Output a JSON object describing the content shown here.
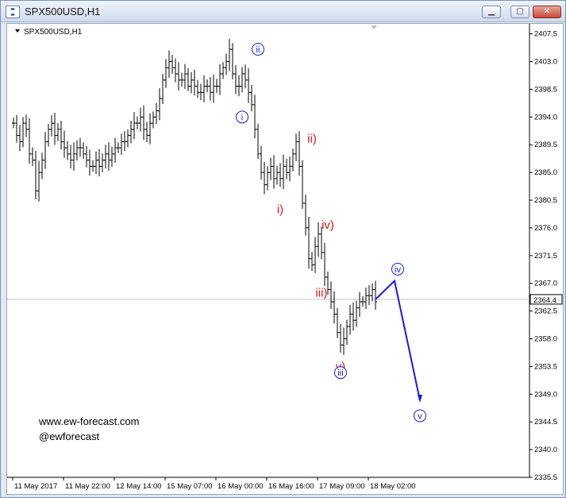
{
  "window": {
    "title": "SPX500USD,H1",
    "icon": "chart-window-icon",
    "buttons": {
      "minimize": "minimize-icon",
      "maximize": "maximize-icon",
      "close": "close-icon"
    }
  },
  "chart": {
    "symbol_label": "SPX500USD,H1",
    "watermark_line1": "www.ew-forecast.com",
    "watermark_line2": "@ewforecast",
    "current_price_label": "2364.4"
  },
  "chart_data": {
    "type": "bar",
    "title": "SPX500USD,H1",
    "ylim": [
      2335.5,
      2409.0
    ],
    "y_ticks": [
      2407.5,
      2403.0,
      2398.5,
      2394.0,
      2389.5,
      2385.0,
      2380.5,
      2376.0,
      2371.5,
      2367.0,
      2362.5,
      2358.0,
      2353.5,
      2349.0,
      2344.5,
      2340.0,
      2335.5
    ],
    "x_tick_labels": [
      "11 May 2017",
      "11 May 22:00",
      "12 May 14:00",
      "15 May 07:00",
      "16 May 00:00",
      "16 May 16:00",
      "17 May 09:00",
      "18 May 02:00"
    ],
    "x_tick_bars": [
      0,
      16,
      32,
      48,
      64,
      80,
      96,
      112
    ],
    "current_price": 2364.4,
    "ohlc_closes": [
      2393,
      2391,
      2390,
      2393,
      2392,
      2388,
      2387,
      2382,
      2385,
      2387,
      2390,
      2392,
      2393,
      2391,
      2392,
      2390,
      2389,
      2388,
      2387,
      2388,
      2389,
      2389,
      2388,
      2387,
      2386,
      2386,
      2387,
      2386,
      2387,
      2388,
      2387,
      2388,
      2389,
      2389,
      2390,
      2390,
      2391,
      2392,
      2393,
      2393,
      2394,
      2392,
      2391,
      2393,
      2394,
      2395,
      2397,
      2400,
      2402,
      2403,
      2402,
      2401,
      2400,
      2400,
      2401,
      2399,
      2400,
      2399,
      2398,
      2398,
      2399,
      2399,
      2398,
      2399,
      2399,
      2401,
      2402,
      2403,
      2405,
      2401,
      2399,
      2399,
      2401,
      2400,
      2398,
      2396,
      2392,
      2388,
      2385,
      2383,
      2385,
      2386,
      2384,
      2385,
      2384,
      2386,
      2385,
      2386,
      2388,
      2390,
      2386,
      2380,
      2376,
      2371,
      2370,
      2373,
      2375,
      2372,
      2368,
      2366,
      2364,
      2362,
      2359,
      2357,
      2358,
      2360,
      2362,
      2361,
      2363,
      2364,
      2364,
      2365,
      2365,
      2366,
      2364
    ],
    "projection": [
      {
        "bar": 114,
        "price": 2364.4
      },
      {
        "bar": 120,
        "price": 2367.4
      },
      {
        "bar": 128,
        "price": 2348.0
      }
    ],
    "annotations": [
      {
        "label": "i",
        "bar": 72,
        "price": 2394.0,
        "color": "#1a1adc",
        "circled": true
      },
      {
        "label": "ii",
        "bar": 77,
        "price": 2405.0,
        "color": "#1a1adc",
        "circled": true
      },
      {
        "label": "i)",
        "bar": 84,
        "price": 2379.0,
        "color": "#dc1414",
        "circled": false
      },
      {
        "label": "ii)",
        "bar": 94,
        "price": 2390.5,
        "color": "#dc1414",
        "circled": false
      },
      {
        "label": "iii)",
        "bar": 97,
        "price": 2365.5,
        "color": "#dc1414",
        "circled": false
      },
      {
        "label": "iv)",
        "bar": 99,
        "price": 2376.5,
        "color": "#dc1414",
        "circled": false
      },
      {
        "label": "v)",
        "bar": 103,
        "price": 2353.5,
        "color": "#dc1414",
        "circled": false
      },
      {
        "label": "iii",
        "bar": 103,
        "price": 2352.5,
        "color": "#1a1adc",
        "circled": true
      },
      {
        "label": "iv",
        "bar": 121,
        "price": 2369.3,
        "color": "#1a1adc",
        "circled": true
      },
      {
        "label": "v",
        "bar": 128,
        "price": 2345.5,
        "color": "#1a1adc",
        "circled": true
      }
    ]
  }
}
